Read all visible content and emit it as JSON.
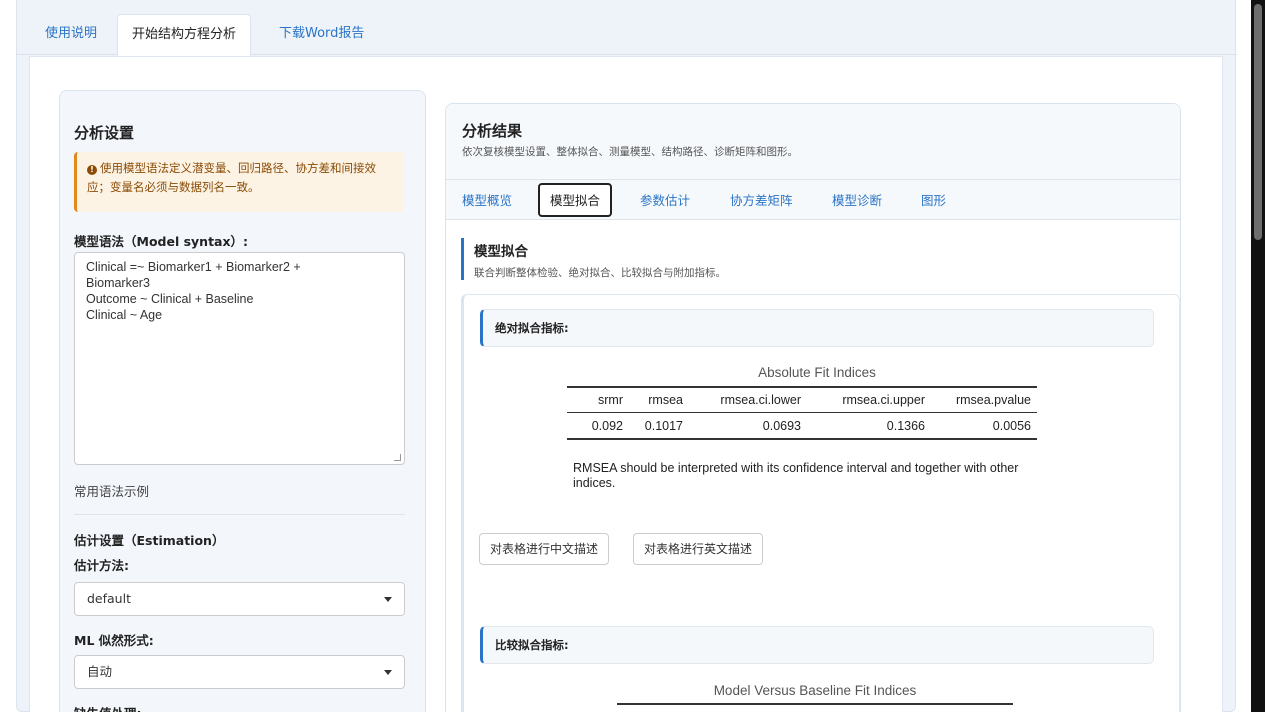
{
  "top_tabs": [
    {
      "label": "使用说明",
      "active": false
    },
    {
      "label": "开始结构方程分析",
      "active": true
    },
    {
      "label": "下载Word报告",
      "active": false
    }
  ],
  "left": {
    "title": "分析设置",
    "alert": "使用模型语法定义潜变量、回归路径、协方差和间接效应；变量名必须与数据列名一致。",
    "syntax_label": "模型语法（Model syntax）:",
    "syntax_value": "Clinical =~ Biomarker1 + Biomarker2 +\nBiomarker3\nOutcome ~ Clinical + Baseline\nClinical ~ Age",
    "examples_label": "常用语法示例",
    "estimation_title": "估计设置（Estimation）",
    "method_label": "估计方法:",
    "method_value": "default",
    "ml_label": "ML 似然形式:",
    "ml_value": "自动",
    "missing_label": "缺失值处理:"
  },
  "right": {
    "title": "分析结果",
    "subtitle": "依次复核模型设置、整体拟合、测量模型、结构路径、诊断矩阵和图形。",
    "tabs": [
      {
        "label": "模型概览",
        "active": false
      },
      {
        "label": "模型拟合",
        "active": true
      },
      {
        "label": "参数估计",
        "active": false
      },
      {
        "label": "协方差矩阵",
        "active": false
      },
      {
        "label": "模型诊断",
        "active": false
      },
      {
        "label": "图形",
        "active": false
      }
    ],
    "section_title": "模型拟合",
    "section_subtitle": "联合判断整体检验、绝对拟合、比较拟合与附加指标。",
    "absolute": {
      "header": "绝对拟合指标:",
      "table_title": "Absolute Fit Indices",
      "columns": [
        "srmr",
        "rmsea",
        "rmsea.ci.lower",
        "rmsea.ci.upper",
        "rmsea.pvalue"
      ],
      "row": [
        "0.092",
        "0.1017",
        "0.0693",
        "0.1366",
        "0.0056"
      ],
      "note": "RMSEA should be interpreted with its confidence interval and together with other indices."
    },
    "buttons": {
      "describe_cn": "对表格进行中文描述",
      "describe_en": "对表格进行英文描述"
    },
    "comparative": {
      "header": "比较拟合指标:",
      "table_title": "Model Versus Baseline Fit Indices"
    }
  }
}
